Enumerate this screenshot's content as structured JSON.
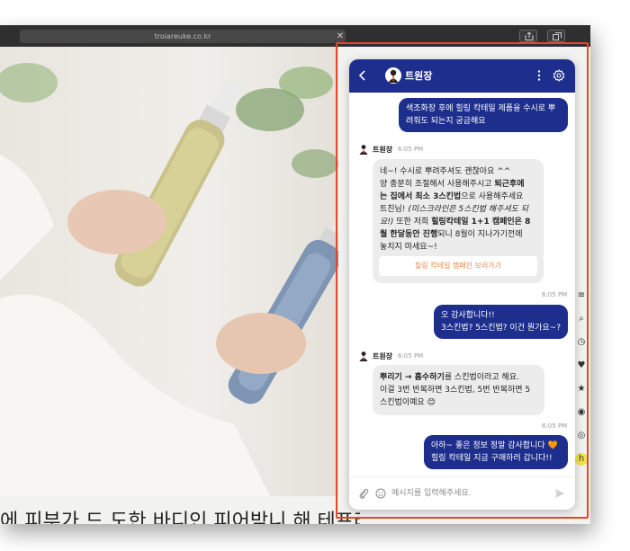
{
  "browser": {
    "url": "troiareuke.co.kr",
    "url_close": "✕"
  },
  "page": {
    "caption": "에 피부가 드 도한 바디인 피어받니 해 테프라키오 \""
  },
  "side_icons": [
    "≡",
    "⌕",
    "◷",
    "♥",
    "★",
    "◉",
    "◎",
    "h"
  ],
  "chat": {
    "agent_name": "트원장",
    "colors": {
      "header": "#1d2e8c",
      "outgoing": "#1d2e8c",
      "incoming": "#ececec",
      "cta_text": "#e88a4a"
    },
    "messages": {
      "m1": {
        "line1": "색조화장 후에 힐링 칵테일 제품을 수시로 뿌",
        "line2": "려줘도 되는지 궁금해요"
      },
      "m2": {
        "sender": "트원장",
        "time": "6:05 PM",
        "l1": "네~! 수시로 뿌려주셔도 괜찮아요 ^^",
        "l2a": "양 충분히 조절해서 사용해주시고 ",
        "l2b": "퇴근후에",
        "l3": "는 집에서 최소 3스킨법",
        "l3b": "으로 사용해주세요",
        "l4": "트친님! ",
        "l4b": "(미스크라인은 5스킨법 해주셔도 되",
        "l5a": "요!)",
        "l5b": " 또한 저희 ",
        "l5c": "힐링칵테일 1+1 캠페인은 8",
        "l6a": "월 한달동안 진행",
        "l6b": "되니 8월이 지나가기전에",
        "l7": "놓치지 마세요~!",
        "cta": "힐링 칵테일 캠페인 보러가기"
      },
      "m3": {
        "time": "6:05 PM",
        "line1": "오 감사합니다!!",
        "line2": "3스킨법? 5스킨법? 이건 뭔가요~?"
      },
      "m4": {
        "sender": "트원장",
        "time": "6:05 PM",
        "l1a": "뿌리기 → 흡수하기",
        "l1b": "를 스킨법이라고 해요.",
        "l2": "이걸 3번 반복하면 3스킨법, 5번 반복하면 5",
        "l3": "스킨법이예요 😊"
      },
      "m5": {
        "time": "6:05 PM",
        "line1": "아하~ 좋은 정보 정말 감사합니다 🧡",
        "line2": "힐링 칵테일 지금 구매하러 갑니다!!"
      }
    },
    "input": {
      "placeholder": "메시지를 입력해주세요."
    }
  }
}
